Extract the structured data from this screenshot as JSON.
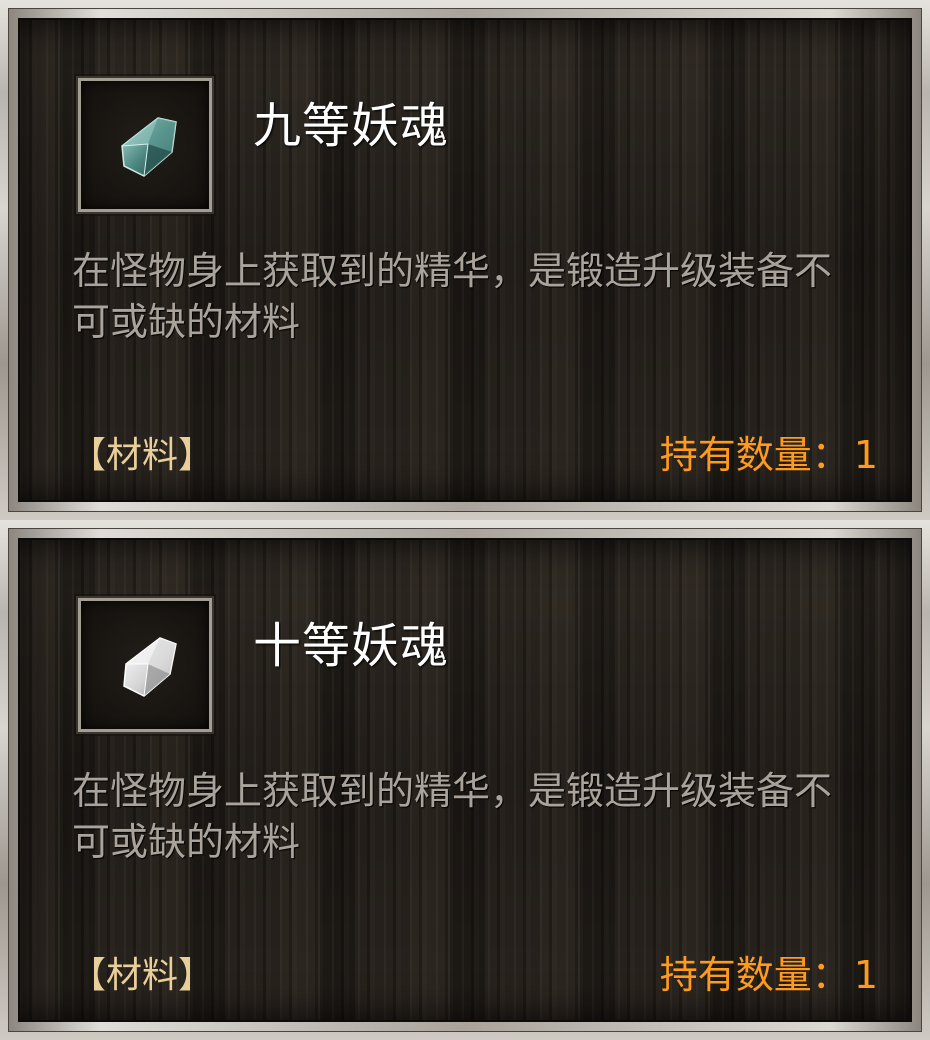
{
  "items": [
    {
      "name": "九等妖魂",
      "icon": "teal-crystal-shard-icon",
      "icon_color": "#4f8a84",
      "description": "在怪物身上获取到的精华，是锻造升级装备不可或缺的材料",
      "type_label": "【材料】",
      "count_label": "持有数量：",
      "count_value": "1"
    },
    {
      "name": "十等妖魂",
      "icon": "white-crystal-shard-icon",
      "icon_color": "#e6e6e6",
      "description": "在怪物身上获取到的精华，是锻造升级装备不可或缺的材料",
      "type_label": "【材料】",
      "count_label": "持有数量：",
      "count_value": "1"
    }
  ]
}
